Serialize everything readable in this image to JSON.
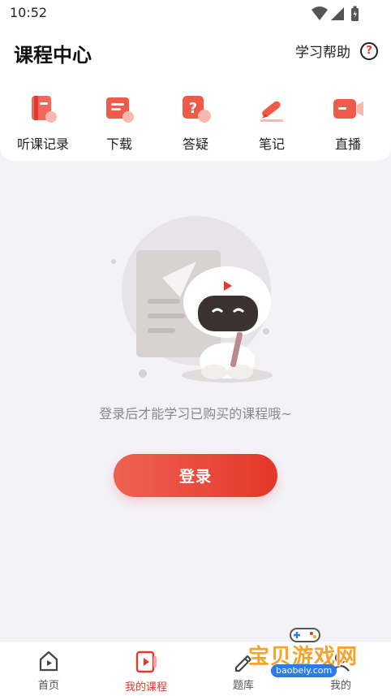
{
  "status_bar": {
    "time": "10:52",
    "icons": [
      "wifi-icon",
      "signal-icon",
      "battery-icon"
    ]
  },
  "header": {
    "title": "课程中心",
    "help_label": "学习帮助",
    "help_icon": "question-icon"
  },
  "shortcuts": [
    {
      "label": "听课记录",
      "icon": "book-icon"
    },
    {
      "label": "下载",
      "icon": "download-icon"
    },
    {
      "label": "答疑",
      "icon": "question-chat-icon"
    },
    {
      "label": "笔记",
      "icon": "pen-icon"
    },
    {
      "label": "直播",
      "icon": "live-camera-icon"
    }
  ],
  "empty_state": {
    "illustration": "robot-illustration",
    "message": "登录后才能学习已购买的课程哦~"
  },
  "login_button": "登录",
  "tab_bar": {
    "items": [
      {
        "label": "首页",
        "icon": "home-play-icon",
        "active": false
      },
      {
        "label": "我的课程",
        "icon": "course-play-icon",
        "active": true
      },
      {
        "label": "题库",
        "icon": "edit-icon",
        "active": false
      },
      {
        "label": "我的",
        "icon": "profile-icon",
        "active": false
      }
    ]
  },
  "watermark": {
    "title": "宝贝游戏网",
    "url": "baobeiy.com"
  },
  "colors": {
    "accent": "#e5372e",
    "background": "#f3f2f6"
  }
}
